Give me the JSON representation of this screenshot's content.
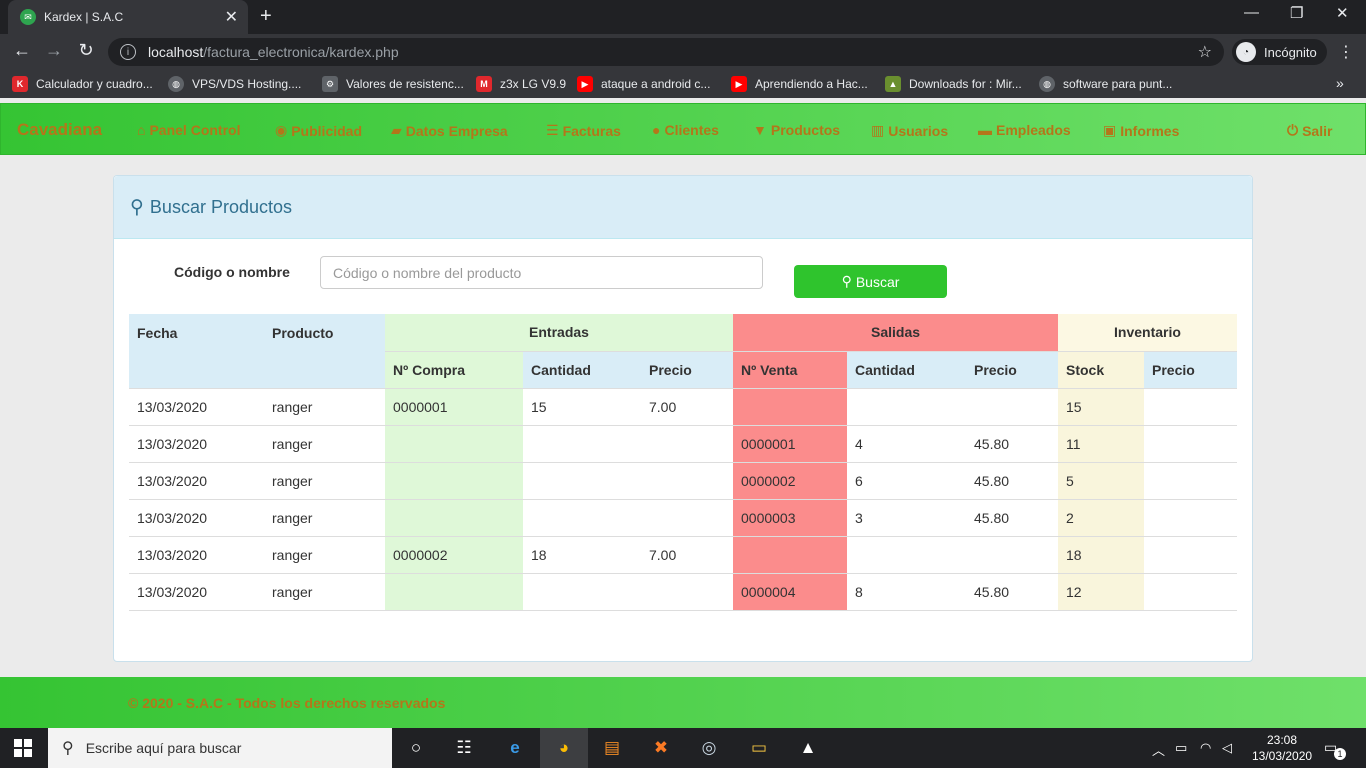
{
  "browser": {
    "tab_title": "Kardex | S.A.C",
    "url_host": "localhost",
    "url_path": "/factura_electronica/kardex.php",
    "incognito_label": "Incógnito",
    "bookmarks": [
      {
        "label": "Calculador y cuadro...",
        "icon_color": "#e0282d",
        "icon_text": "K"
      },
      {
        "label": "VPS/VDS Hosting....",
        "icon_color": "#5f6368",
        "icon_text": ""
      },
      {
        "label": "Valores de resistenc...",
        "icon_color": "#5f6368",
        "icon_text": ""
      },
      {
        "label": "z3x LG V9.9",
        "icon_color": "#e0282d",
        "icon_text": "M"
      },
      {
        "label": "ataque a android c...",
        "icon_color": "#ff0000",
        "icon_text": "▶"
      },
      {
        "label": "Aprendiendo a Hac...",
        "icon_color": "#ff0000",
        "icon_text": "▶"
      },
      {
        "label": "Downloads for : Mir...",
        "icon_color": "#6a8f2f",
        "icon_text": ""
      },
      {
        "label": "software para punt...",
        "icon_color": "#5f6368",
        "icon_text": ""
      }
    ]
  },
  "navbar": {
    "brand": "Cavadiana",
    "items": [
      {
        "label": "Panel Control",
        "icon": "home-icon",
        "glyph": "⌂"
      },
      {
        "label": "Publicidad",
        "icon": "eye-icon",
        "glyph": "◉"
      },
      {
        "label": "Datos Empresa",
        "icon": "folder-icon",
        "glyph": "▰"
      },
      {
        "label": "Facturas",
        "icon": "list-icon",
        "glyph": "☰"
      },
      {
        "label": "Clientes",
        "icon": "user-icon",
        "glyph": "●"
      },
      {
        "label": "Productos",
        "icon": "cart-icon",
        "glyph": "▼"
      },
      {
        "label": "Usuarios",
        "icon": "barcode-icon",
        "glyph": "▥"
      },
      {
        "label": "Empleados",
        "icon": "briefcase-icon",
        "glyph": "▬"
      },
      {
        "label": "Informes",
        "icon": "gift-icon",
        "glyph": "▣"
      }
    ],
    "logout": {
      "label": "Salir",
      "icon": "power-icon",
      "glyph": "⏻"
    }
  },
  "panel": {
    "title": "Buscar Productos",
    "search_label": "Código o nombre",
    "search_placeholder": "Código o nombre del producto",
    "search_button": "Buscar"
  },
  "table": {
    "headers": {
      "fecha": "Fecha",
      "producto": "Producto",
      "entradas": "Entradas",
      "salidas": "Salidas",
      "inventario": "Inventario",
      "n_compra": "Nº Compra",
      "cantidad_e": "Cantidad",
      "precio_e": "Precio",
      "n_venta": "Nº Venta",
      "cantidad_s": "Cantidad",
      "precio_s": "Precio",
      "stock": "Stock",
      "precio_i": "Precio"
    },
    "rows": [
      {
        "fecha": "13/03/2020",
        "producto": "ranger",
        "n_compra": "0000001",
        "cantidad_e": "15",
        "precio_e": "7.00",
        "n_venta": "",
        "cantidad_s": "",
        "precio_s": "",
        "stock": "15",
        "precio_i": ""
      },
      {
        "fecha": "13/03/2020",
        "producto": "ranger",
        "n_compra": "",
        "cantidad_e": "",
        "precio_e": "",
        "n_venta": "0000001",
        "cantidad_s": "4",
        "precio_s": "45.80",
        "stock": "11",
        "precio_i": ""
      },
      {
        "fecha": "13/03/2020",
        "producto": "ranger",
        "n_compra": "",
        "cantidad_e": "",
        "precio_e": "",
        "n_venta": "0000002",
        "cantidad_s": "6",
        "precio_s": "45.80",
        "stock": "5",
        "precio_i": ""
      },
      {
        "fecha": "13/03/2020",
        "producto": "ranger",
        "n_compra": "",
        "cantidad_e": "",
        "precio_e": "",
        "n_venta": "0000003",
        "cantidad_s": "3",
        "precio_s": "45.80",
        "stock": "2",
        "precio_i": ""
      },
      {
        "fecha": "13/03/2020",
        "producto": "ranger",
        "n_compra": "0000002",
        "cantidad_e": "18",
        "precio_e": "7.00",
        "n_venta": "",
        "cantidad_s": "",
        "precio_s": "",
        "stock": "18",
        "precio_i": ""
      },
      {
        "fecha": "13/03/2020",
        "producto": "ranger",
        "n_compra": "",
        "cantidad_e": "",
        "precio_e": "",
        "n_venta": "0000004",
        "cantidad_s": "8",
        "precio_s": "45.80",
        "stock": "12",
        "precio_i": ""
      }
    ]
  },
  "footer": {
    "text": "© 2020 - S.A.C - Todos los derechos reservados"
  },
  "taskbar": {
    "search_placeholder": "Escribe aquí para buscar",
    "time": "23:08",
    "date": "13/03/2020",
    "notification_count": "1"
  },
  "colors": {
    "nav_green": "#35c433",
    "nav_text": "#b4761a",
    "info": "#d9edf7",
    "success": "#dff0d8",
    "danger": "#fb8c8c",
    "warning": "#fcf8e3"
  }
}
